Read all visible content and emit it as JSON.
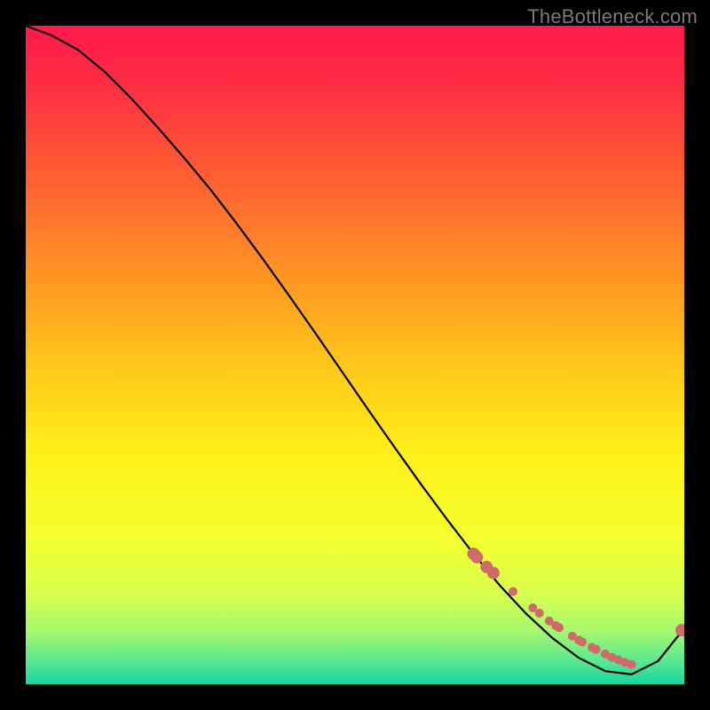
{
  "watermark": "TheBottleneck.com",
  "chart_data": {
    "type": "line",
    "title": "",
    "xlabel": "",
    "ylabel": "",
    "xlim": [
      0,
      100
    ],
    "ylim": [
      0,
      100
    ],
    "grid": false,
    "legend": false,
    "curve": {
      "x": [
        0,
        4,
        8,
        12,
        16,
        20,
        24,
        28,
        32,
        36,
        40,
        44,
        48,
        52,
        56,
        60,
        64,
        68,
        72,
        76,
        80,
        84,
        88,
        92,
        96,
        100
      ],
      "y": [
        100,
        98.5,
        96.3,
        93,
        89,
        84.6,
        80,
        75.2,
        70,
        64.6,
        59,
        53.3,
        47.5,
        41.7,
        36,
        30.4,
        25,
        19.8,
        15,
        10.7,
        7,
        4,
        2,
        1.5,
        3.5,
        8.5
      ]
    },
    "markers": {
      "x": [
        68,
        68.5,
        70,
        71,
        74,
        77,
        78,
        79.5,
        80.5,
        81,
        83,
        84,
        84.5,
        86,
        86.6,
        88,
        89,
        90,
        91,
        92,
        99.6
      ],
      "y": [
        19.8,
        19.3,
        17.8,
        16.9,
        14.1,
        11.6,
        10.8,
        9.6,
        8.9,
        8.6,
        7.3,
        6.7,
        6.4,
        5.6,
        5.3,
        4.6,
        4.1,
        3.7,
        3.3,
        3.0,
        8.2
      ]
    },
    "marker_style": {
      "color": "#cf6a6a",
      "size_main": 7,
      "size_small": 5
    },
    "background_gradient": {
      "stops": [
        {
          "offset": 0.0,
          "color": "#ff1a49"
        },
        {
          "offset": 0.08,
          "color": "#ff2a45"
        },
        {
          "offset": 0.2,
          "color": "#ff5436"
        },
        {
          "offset": 0.35,
          "color": "#ff8a26"
        },
        {
          "offset": 0.5,
          "color": "#ffc11a"
        },
        {
          "offset": 0.65,
          "color": "#fff01a"
        },
        {
          "offset": 0.78,
          "color": "#f4ff2e"
        },
        {
          "offset": 0.86,
          "color": "#d8ff4d"
        },
        {
          "offset": 0.92,
          "color": "#a6f86e"
        },
        {
          "offset": 0.965,
          "color": "#58e892"
        },
        {
          "offset": 1.0,
          "color": "#18d7a0"
        }
      ]
    }
  }
}
